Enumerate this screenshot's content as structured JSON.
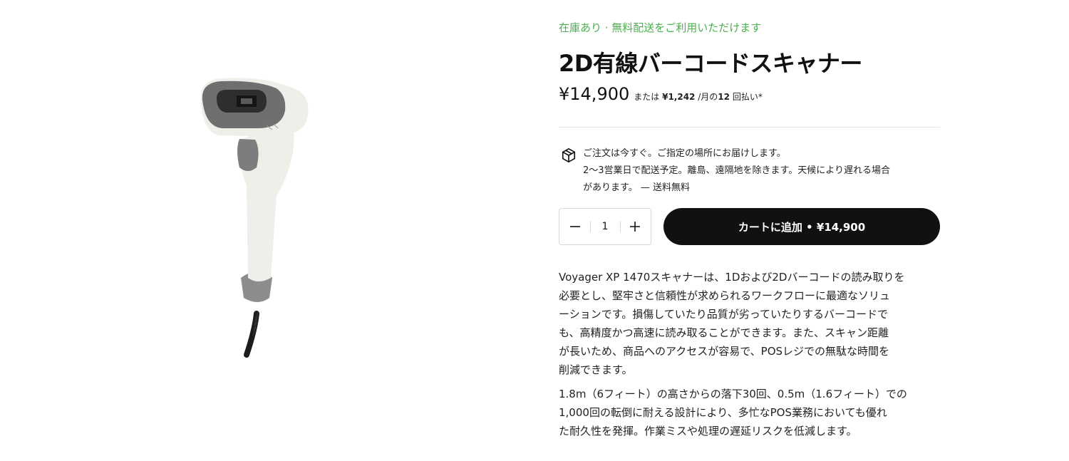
{
  "product": {
    "stock_text": "在庫あり · 無料配送をご利用いただけます",
    "title": "2D有線バーコードスキャナー",
    "price": "¥14,900",
    "installment": {
      "prefix": "または",
      "amount": "¥1,242",
      "per_month": "/月の",
      "count": "12",
      "suffix": "回払い*"
    }
  },
  "delivery": {
    "icon": "package-icon",
    "line1": "ご注文は今すぐ。ご指定の場所にお届けします。",
    "line2": "2〜3営業日で配送予定。離島、遠隔地を除きます。天候により遅れる場合",
    "line3": "があります。 — 送料無料"
  },
  "quantity": {
    "value": "1"
  },
  "cart_button": {
    "label": "カートに追加 • ¥14,900"
  },
  "description": {
    "paragraph1_lines": [
      "Voyager XP 1470スキャナーは、1Dおよび2Dバーコードの読み取りを",
      "必要とし、堅牢さと信頼性が求められるワークフローに最適なソリュ",
      "ーションです。損傷していたり品質が劣っていたりするバーコードで",
      "も、高精度かつ高速に読み取ることができます。また、スキャン距離",
      "が長いため、商品へのアクセスが容易で、POSレジでの無駄な時間を",
      "削減できます。"
    ],
    "paragraph2_lines": [
      "1.8m（6フィート）の高さからの落下30回、0.5m（1.6フィート）での",
      "1,000回の転倒に耐える設計により、多忙なPOS業務においても優れ",
      "た耐久性を発揮。作業ミスや処理の遅延リスクを低減します。"
    ]
  },
  "colors": {
    "stock_green": "#4caf50",
    "button_black": "#111111"
  }
}
